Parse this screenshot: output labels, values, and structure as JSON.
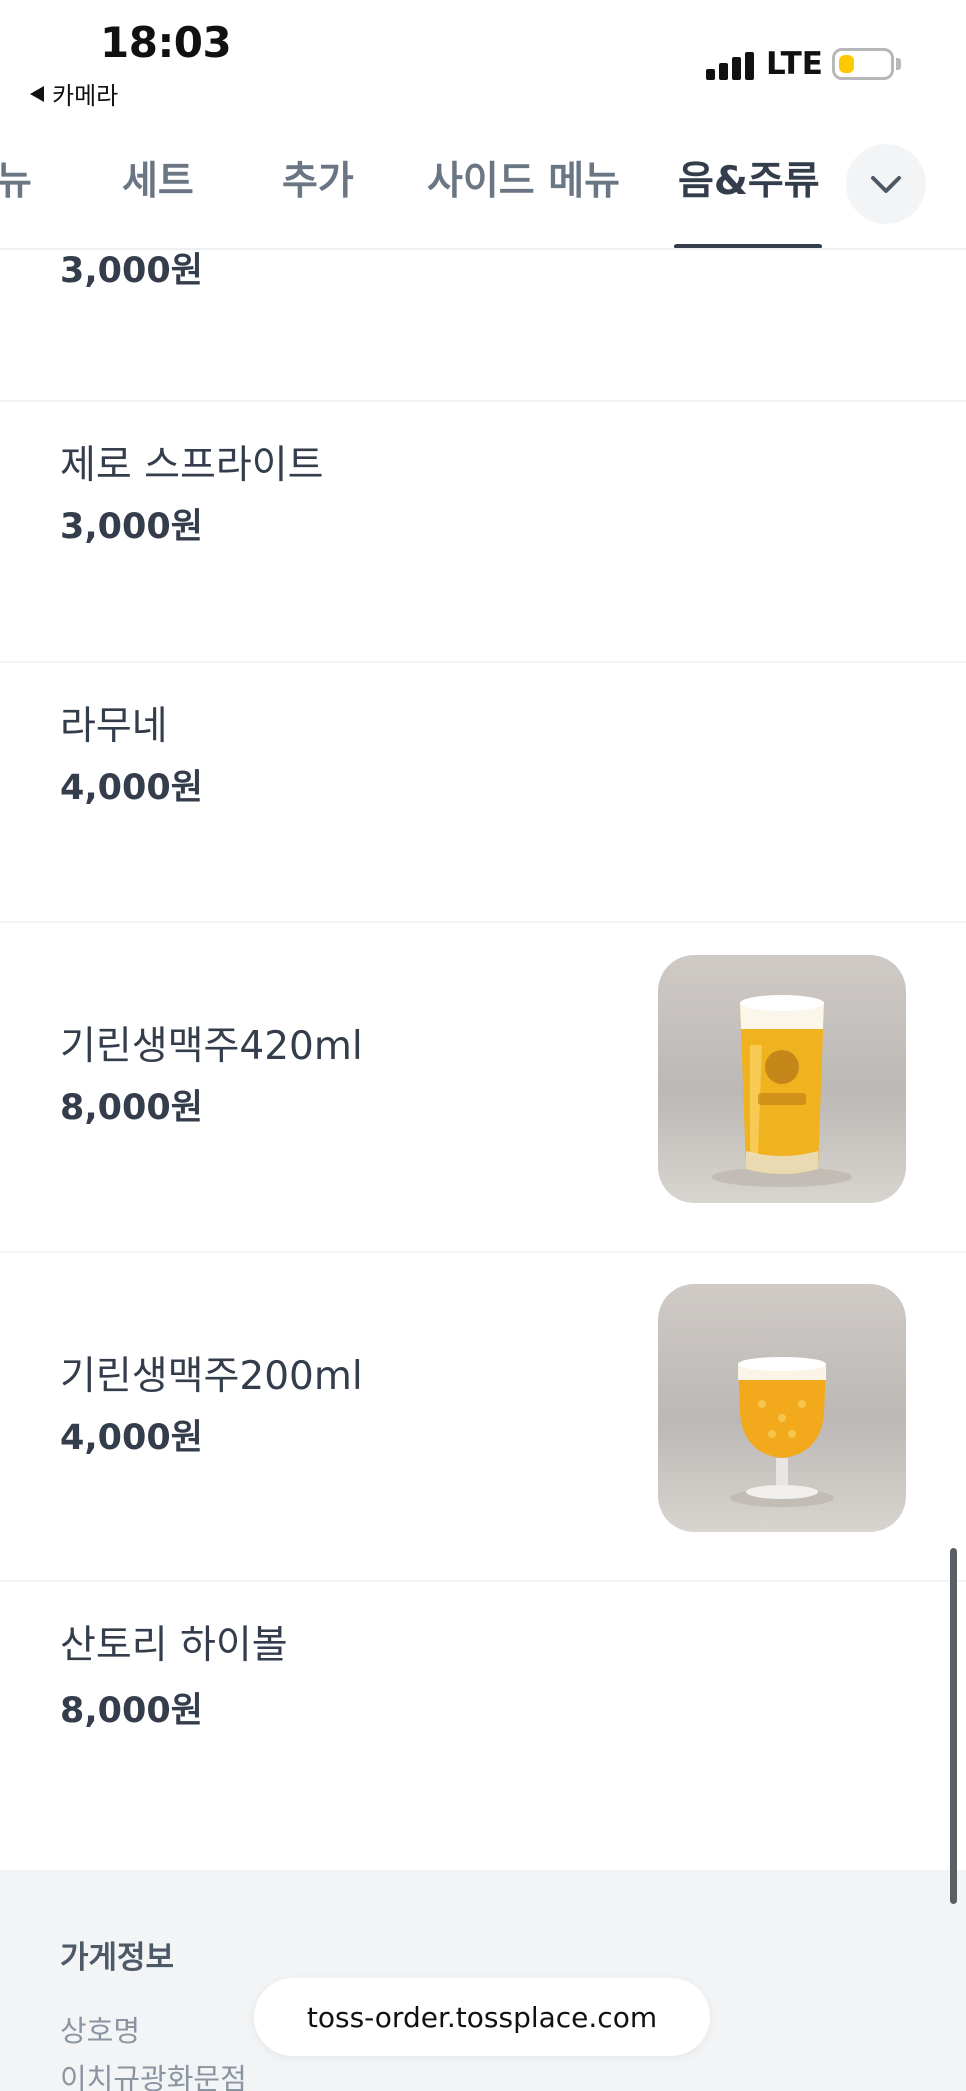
{
  "status_bar": {
    "time": "18:03",
    "back_label": "카메라",
    "network": "LTE",
    "battery_level": 0.3,
    "battery_color": "#ffc800"
  },
  "tabs": [
    {
      "label": "뉴",
      "active": false
    },
    {
      "label": "세트",
      "active": false
    },
    {
      "label": "추가",
      "active": false
    },
    {
      "label": "사이드 메뉴",
      "active": false
    },
    {
      "label": "음&주류",
      "active": true
    }
  ],
  "tab_more_icon": "chevron-down-icon",
  "menu": [
    {
      "name": "",
      "price": "3,000원"
    },
    {
      "name": "제로 스프라이트",
      "price": "3,000원"
    },
    {
      "name": "라무네",
      "price": "4,000원"
    },
    {
      "name": "기린생맥주420ml",
      "price": "8,000원",
      "image": "beer-420-photo"
    },
    {
      "name": "기린생맥주200ml",
      "price": "4,000원",
      "image": "beer-200-photo"
    },
    {
      "name": "산토리 하이볼",
      "price": "8,000원"
    }
  ],
  "store_info": {
    "title": "가게정보",
    "name_label": "상호명",
    "name_value": "이치규광화문점"
  },
  "url_bar": {
    "url": "toss-order.tossplace.com"
  },
  "colors": {
    "text_primary": "#333d4b",
    "text_secondary": "#6b7684",
    "info_bg": "#f2f4f6"
  }
}
